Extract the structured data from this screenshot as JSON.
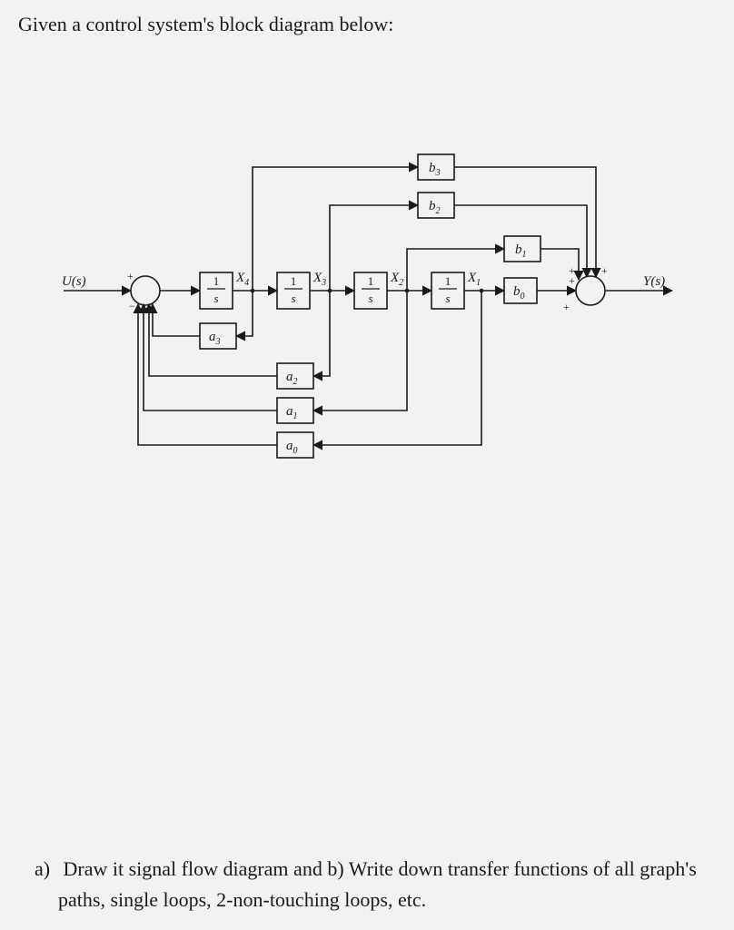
{
  "intro": "Given a control system's block diagram below:",
  "question": {
    "letter": "a)",
    "text": "Draw it signal flow diagram and b) Write down transfer functions of all graph's paths, single loops, 2-non-touching loops, etc."
  },
  "diagram": {
    "input_label": "U(s)",
    "output_label": "Y(s)",
    "integrators": [
      {
        "num": "1",
        "den": "s",
        "state": "X",
        "state_sub": "4"
      },
      {
        "num": "1",
        "den": "s",
        "state": "X",
        "state_sub": "3"
      },
      {
        "num": "1",
        "den": "s",
        "state": "X",
        "state_sub": "2"
      },
      {
        "num": "1",
        "den": "s",
        "state": "X",
        "state_sub": "1"
      }
    ],
    "feedback_blocks": [
      {
        "base": "a",
        "sub": "3"
      },
      {
        "base": "a",
        "sub": "2"
      },
      {
        "base": "a",
        "sub": "1"
      },
      {
        "base": "a",
        "sub": "0"
      }
    ],
    "forward_blocks": [
      {
        "base": "b",
        "sub": "3"
      },
      {
        "base": "b",
        "sub": "2"
      },
      {
        "base": "b",
        "sub": "1"
      },
      {
        "base": "b",
        "sub": "0"
      }
    ],
    "sum1_signs": {
      "in": "+",
      "fb": "−"
    },
    "sum2_signs": {
      "all": "+"
    }
  }
}
